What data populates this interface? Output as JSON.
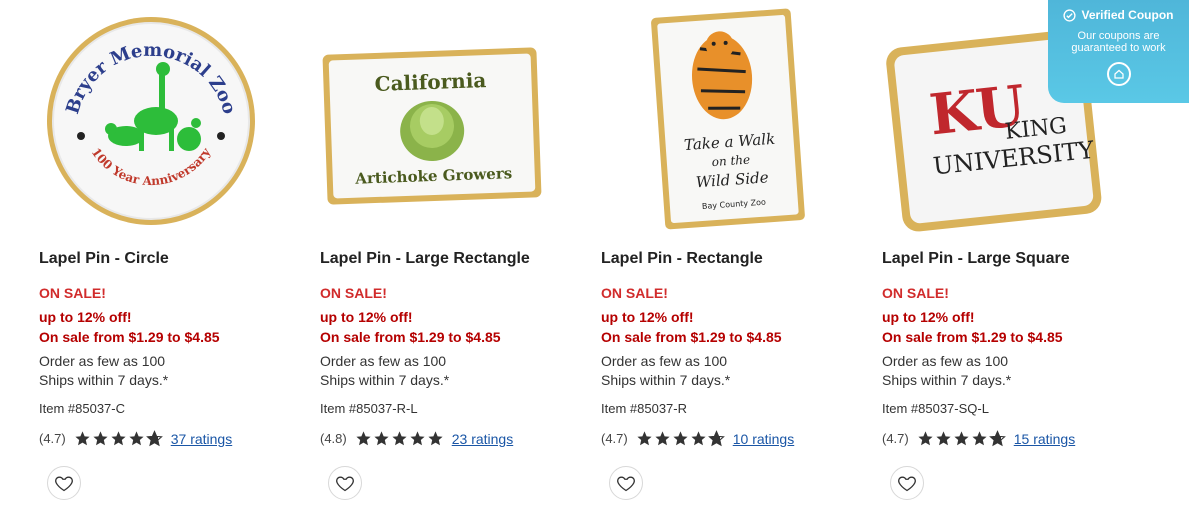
{
  "products": [
    {
      "title": "Lapel Pin - Circle",
      "sale_label": "ON SALE!",
      "discount": "up to 12% off!",
      "price_range": "On sale from $1.29 to $4.85",
      "min_order": "Order as few as 100",
      "ships": "Ships within 7 days.*",
      "item_number": "Item #85037-C",
      "rating": "(4.7)",
      "ratings_count": "37 ratings",
      "image_text": {
        "arc_top": "Bryer Memorial Zoo",
        "arc_bottom": "100 Year Anniversary"
      }
    },
    {
      "title": "Lapel Pin - Large Rectangle",
      "sale_label": "ON SALE!",
      "discount": "up to 12% off!",
      "price_range": "On sale from $1.29 to $4.85",
      "min_order": "Order as few as 100",
      "ships": "Ships within 7 days.*",
      "item_number": "Item #85037-R-L",
      "rating": "(4.8)",
      "ratings_count": "23 ratings",
      "image_text": {
        "top": "California",
        "bottom": "Artichoke Growers"
      }
    },
    {
      "title": "Lapel Pin - Rectangle",
      "sale_label": "ON SALE!",
      "discount": "up to 12% off!",
      "price_range": "On sale from $1.29 to $4.85",
      "min_order": "Order as few as 100",
      "ships": "Ships within 7 days.*",
      "item_number": "Item #85037-R",
      "rating": "(4.7)",
      "ratings_count": "10 ratings",
      "image_text": {
        "line1": "Take a Walk",
        "line2": "on the",
        "line3": "Wild Side",
        "line4": "Bay County Zoo"
      }
    },
    {
      "title": "Lapel Pin - Large Square",
      "sale_label": "ON SALE!",
      "discount": "up to 12% off!",
      "price_range": "On sale from $1.29 to $4.85",
      "min_order": "Order as few as 100",
      "ships": "Ships within 7 days.*",
      "item_number": "Item #85037-SQ-L",
      "rating": "(4.7)",
      "ratings_count": "15 ratings",
      "image_text": {
        "mark": "KU",
        "line1": "KING",
        "line2": "UNIVERSITY"
      }
    }
  ],
  "coupon": {
    "title": "Verified Coupon",
    "text": "Our coupons are guaranteed to work",
    "bg_color": "#4fb6d9"
  },
  "colors": {
    "sale_red": "#d12b2b",
    "price_red": "#b50000",
    "link_blue": "#1a56a6",
    "star": "#333333"
  }
}
